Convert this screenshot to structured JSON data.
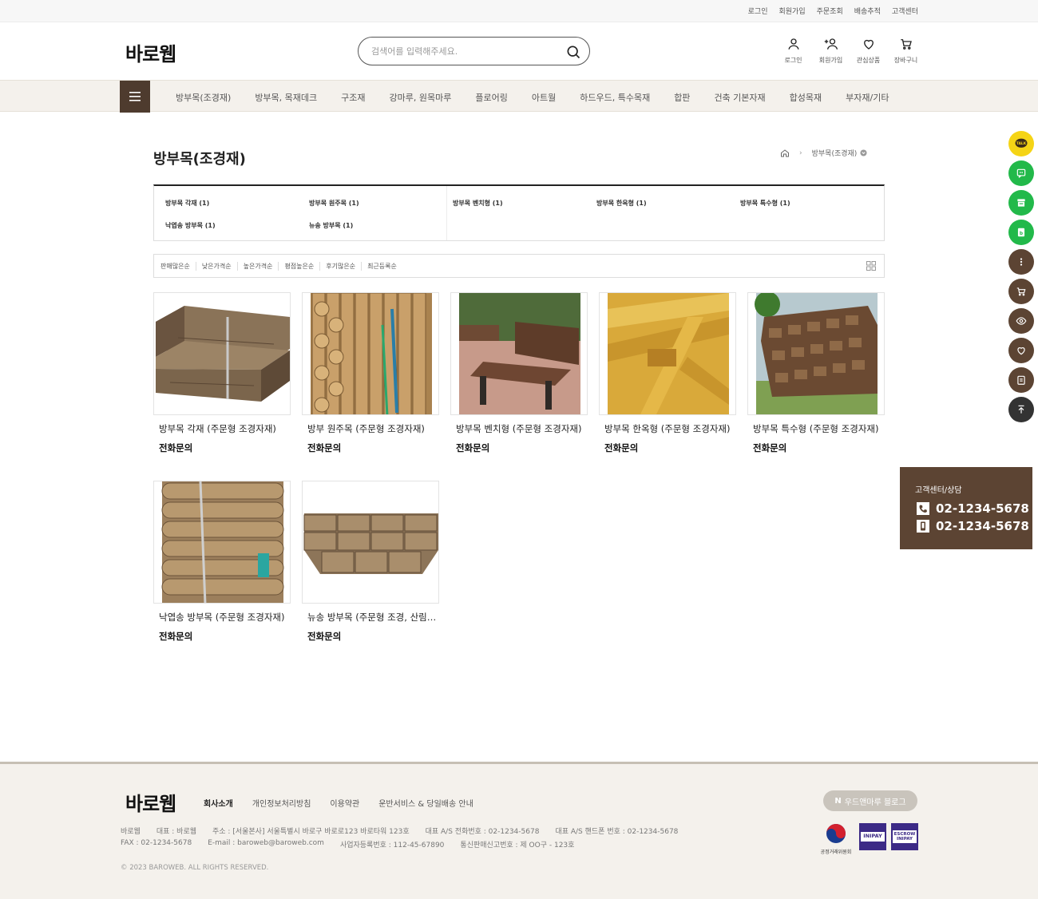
{
  "topbar": {
    "links": [
      "로그인",
      "회원가입",
      "주문조회",
      "배송추적",
      "고객센터"
    ]
  },
  "header": {
    "logo": "바로웹",
    "search_placeholder": "검색어를 입력해주세요.",
    "icons": [
      {
        "label": "로그인",
        "icon": "user-icon"
      },
      {
        "label": "회원가입",
        "icon": "user-plus-icon"
      },
      {
        "label": "관심상품",
        "icon": "heart-icon"
      },
      {
        "label": "장바구니",
        "icon": "cart-icon"
      }
    ]
  },
  "nav": {
    "items": [
      "방부목(조경재)",
      "방부목, 목재데크",
      "구조재",
      "강마루, 원목마루",
      "플로어링",
      "아트월",
      "하드우드, 특수목재",
      "합판",
      "건축 기본자재",
      "합성목재",
      "부자재/기타"
    ]
  },
  "page": {
    "title": "방부목(조경재)",
    "breadcrumb_current": "방부목(조경재)"
  },
  "subcategories": [
    "방부목 각재 (1)",
    "방부목 원주목 (1)",
    "방부목 벤치형 (1)",
    "방부목 한옥형 (1)",
    "방부목 특수형 (1)",
    "낙엽송 방부목 (1)",
    "뉴송 방부목 (1)"
  ],
  "sort": {
    "options": [
      "판매많은순",
      "낮은가격순",
      "높은가격순",
      "평점높은순",
      "후기많은순",
      "최근등록순"
    ]
  },
  "products": [
    {
      "name": "방부목 각재 (주문형 조경자재)",
      "price": "전화문의"
    },
    {
      "name": "방부 원주목 (주문형 조경자재)",
      "price": "전화문의"
    },
    {
      "name": "방부목 벤치형 (주문형 조경자재)",
      "price": "전화문의"
    },
    {
      "name": "방부목 한옥형 (주문형 조경자재)",
      "price": "전화문의"
    },
    {
      "name": "방부목 특수형 (주문형 조경자재)",
      "price": "전화문의"
    },
    {
      "name": "낙엽송 방부목 (주문형 조경자재)",
      "price": "전화문의"
    },
    {
      "name": "뉴송 방부목 (주문형 조경, 산림자재)",
      "price": "전화문의"
    }
  ],
  "consult": {
    "title": "고객센터/상담",
    "phone1": "02-1234-5678",
    "phone2": "02-1234-5678"
  },
  "quickbar": {
    "talk_label": "TALK",
    "colors": {
      "talk": "#f5d416",
      "green": "#22b94a",
      "brown": "#5c4433",
      "dark": "#333333"
    }
  },
  "footer": {
    "logo": "바로웹",
    "links": [
      "회사소개",
      "개인정보처리방침",
      "이용약관",
      "운반서비스 & 당일배송 안내"
    ],
    "blog": "우드앤마루 블로그",
    "row1": [
      "바로웹",
      "대표 : 바로웹",
      "주소 : [서울본사] 서울특별시 바로구 바로로123 바로타워 123호",
      "대표 A/S 전화번호 : 02-1234-5678",
      "대표 A/S 핸드폰 번호 : 02-1234-5678"
    ],
    "row2": [
      "FAX : 02-1234-5678",
      "E-mail : baroweb@baroweb.com",
      "사업자등록번호 : 112-45-67890",
      "통신판매신고번호 : 제 OO구 - 123호"
    ],
    "copyright": "© 2023 BAROWEB. ALL RIGHTS RESERVED.",
    "ftc_label": "공정거래위원회",
    "inipay1": "INIPAY",
    "inipay2_top": "ESCROW",
    "inipay2": "INIPAY"
  },
  "colors": {
    "accent": "#4e3b2e",
    "nav_bg": "#f4f1ec",
    "footer_bg": "#f4f1ec"
  }
}
